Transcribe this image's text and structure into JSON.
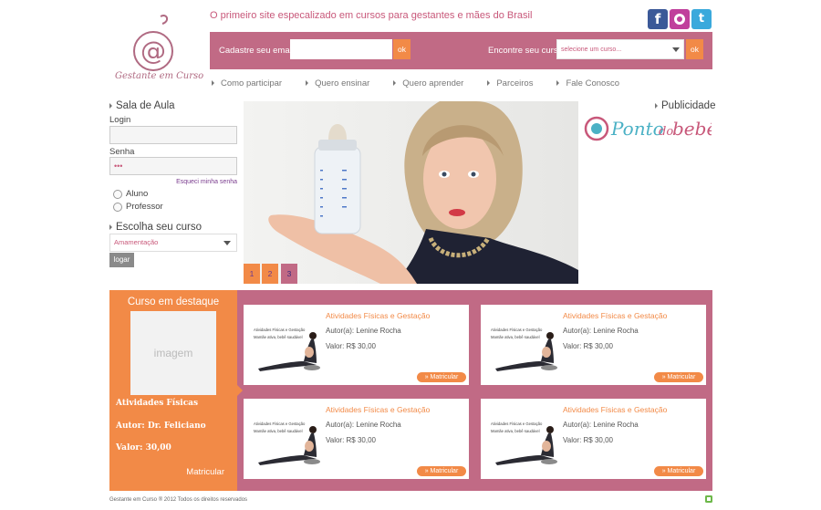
{
  "header": {
    "logo_text": "Gestante em Curso",
    "tagline": "O primeiro site especalizado em cursos para gestantes e mães do Brasil",
    "social": [
      {
        "name": "facebook-icon",
        "glyph": "f"
      },
      {
        "name": "orkut-icon",
        "glyph": ""
      },
      {
        "name": "twitter-icon",
        "glyph": "t"
      }
    ]
  },
  "bar": {
    "email_label": "Cadastre seu email",
    "email_value": "",
    "ok_label": "ok",
    "find_label": "Encontre seu curso",
    "select_value": "selecione um curso..."
  },
  "nav": {
    "items": [
      "Como participar",
      "Quero ensinar",
      "Quero aprender",
      "Parceiros",
      "Fale Conosco"
    ]
  },
  "sidebar": {
    "title": "Sala de Aula",
    "login_label": "Login",
    "login_value": "",
    "password_label": "Senha",
    "password_value": "•••",
    "forgot": "Esqueci minha senha",
    "radio_aluno": "Aluno",
    "radio_professor": "Professor",
    "choose_title": "Escolha seu curso",
    "course_value": "Amamentação",
    "submit": "logar"
  },
  "slider": {
    "pages": [
      "1",
      "2",
      "3"
    ],
    "active_page": 3
  },
  "ads": {
    "title": "Publicidade",
    "brand_a": "Ponto",
    "brand_b": "do",
    "brand_c": "bebê"
  },
  "featured": {
    "title": "Curso em destaque",
    "image_placeholder": "imagem",
    "course": "Atividades Físicas",
    "author": "Autor: Dr. Feliciano",
    "price": "Valor: 30,00",
    "cta": "Matricular"
  },
  "courses": [
    {
      "title": "Atividades Físicas e Gestação",
      "author": "Autor(a): Lenine Rocha",
      "price": "Valor: R$ 30,00",
      "img_t1": "Atividades Físicas e Gestação",
      "img_t2": "Mamãe ativa, bebê saudável",
      "cta": "» Matricular"
    },
    {
      "title": "Atividades Físicas e Gestação",
      "author": "Autor(a): Lenine Rocha",
      "price": "Valor: R$ 30,00",
      "img_t1": "Atividades Físicas e Gestação",
      "img_t2": "Mamãe ativa, bebê saudável",
      "cta": "» Matricular"
    },
    {
      "title": "Atividades Físicas e Gestação",
      "author": "Autor(a): Lenine Rocha",
      "price": "Valor: R$ 30,00",
      "img_t1": "Atividades Físicas e Gestação",
      "img_t2": "Mamãe ativa, bebê saudável",
      "cta": "» Matricular"
    },
    {
      "title": "Atividades Físicas e Gestação",
      "author": "Autor(a): Lenine Rocha",
      "price": "Valor: R$ 30,00",
      "img_t1": "Atividades Físicas e Gestação",
      "img_t2": "Mamãe ativa, bebê saudável",
      "cta": "» Matricular"
    }
  ],
  "footer": {
    "copyright": "Gestante em Curso ® 2012 Todos os direitos reservados"
  },
  "colors": {
    "brand_pink": "#c16a85",
    "brand_orange": "#f28a47",
    "text_pink": "#c8587a"
  }
}
